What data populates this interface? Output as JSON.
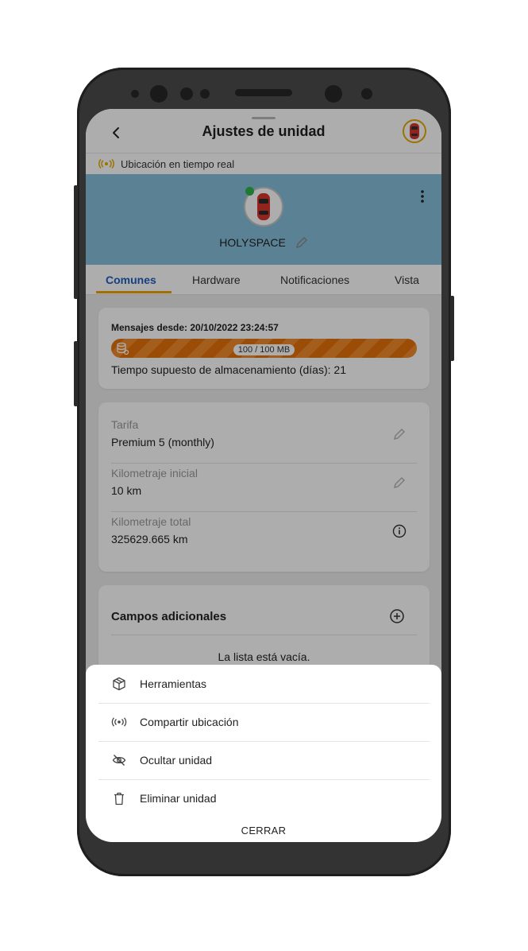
{
  "header": {
    "title": "Ajustes de unidad",
    "back_icon": "back-arrow-icon",
    "unit_thumb_icon": "car-icon"
  },
  "live_location": {
    "label": "Ubicación en tiempo real",
    "icon": "broadcast-icon",
    "icon_color": "#e6a800"
  },
  "unit": {
    "name": "HOLYSPACE",
    "status_color": "#2db34a",
    "hero_color": "#87bfdc"
  },
  "tabs": [
    {
      "label": "Comunes"
    },
    {
      "label": "Hardware"
    },
    {
      "label": "Notificaciones"
    },
    {
      "label": "Vista"
    }
  ],
  "storage": {
    "messages_since": "Mensajes desde: 20/10/2022 23:24:57",
    "usage_label": "100 / 100 MB",
    "usage_fraction": 1.0,
    "estimate": "Tiempo supuesto de almacenamiento (días): 21",
    "bar_color": "#e5720c"
  },
  "details": [
    {
      "label": "Tarifa",
      "value": "Premium 5 (monthly)",
      "action_icon": "pencil-icon"
    },
    {
      "label": "Kilometraje inicial",
      "value": "10 km",
      "action_icon": "pencil-icon"
    },
    {
      "label": "Kilometraje total",
      "value": "325629.665 km",
      "action_icon": "info-icon"
    }
  ],
  "extra_fields": {
    "title": "Campos adicionales",
    "empty_text": "La lista está vacía."
  },
  "sheet": {
    "items": [
      {
        "label": "Herramientas",
        "icon": "package-icon"
      },
      {
        "label": "Compartir ubicación",
        "icon": "broadcast-icon"
      },
      {
        "label": "Ocultar unidad",
        "icon": "eye-off-icon"
      },
      {
        "label": "Eliminar unidad",
        "icon": "trash-icon"
      }
    ],
    "close_label": "CERRAR"
  },
  "colors": {
    "accent": "#f0a400",
    "active_tab": "#1f5fbf"
  }
}
